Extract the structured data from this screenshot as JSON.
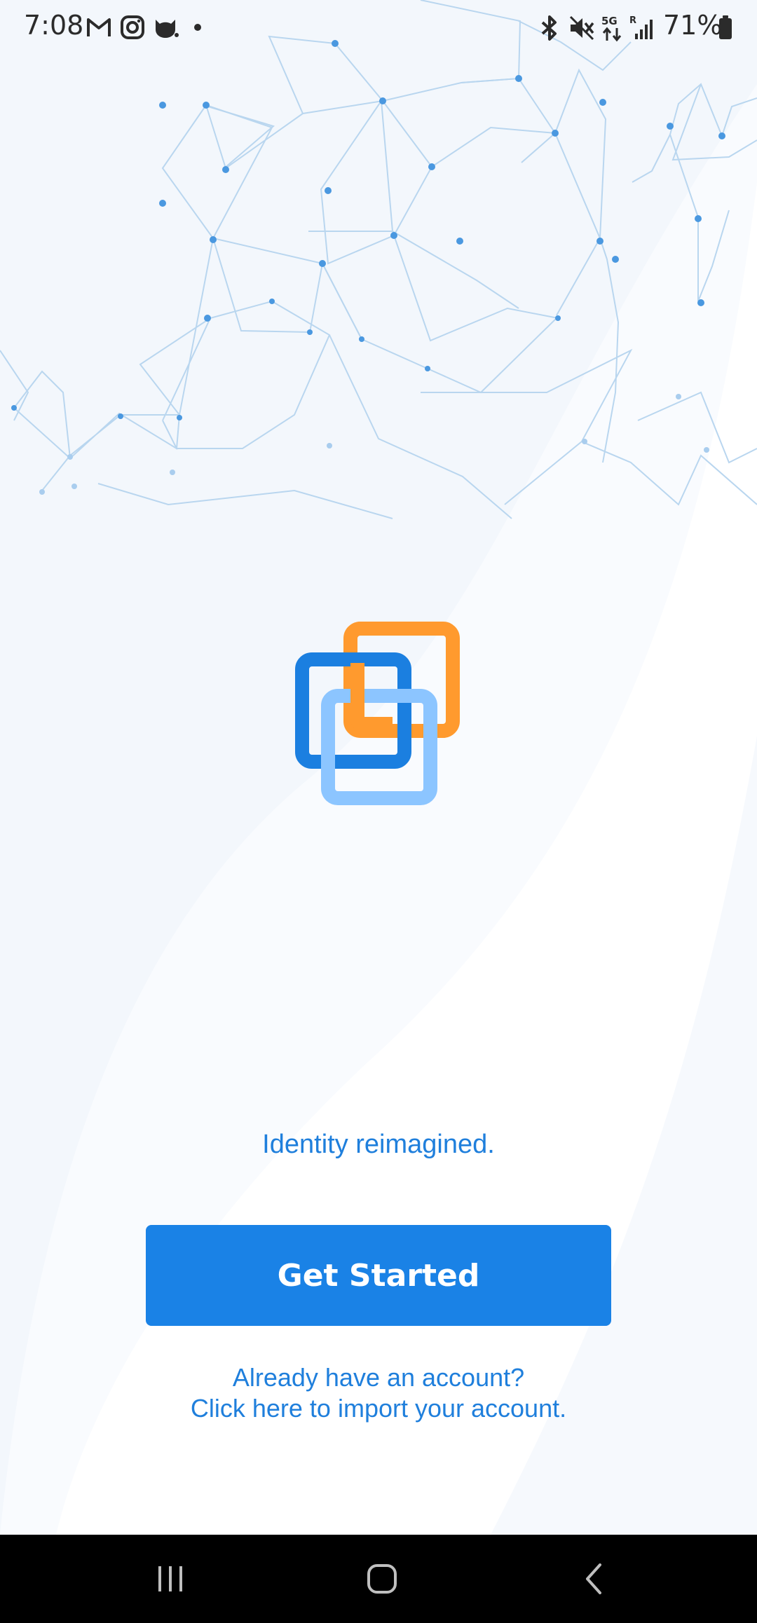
{
  "status_bar": {
    "time": "7:08",
    "battery_percent": "71%",
    "left_icons": [
      "gmail-icon",
      "instagram-icon",
      "cat-app-icon",
      "dot-icon"
    ],
    "right_icons": [
      "bluetooth-icon",
      "mute-icon",
      "5g-icon",
      "signal-icon",
      "battery-icon"
    ]
  },
  "onboarding": {
    "tagline": "Identity reimagined.",
    "cta_label": "Get Started",
    "import_line1": "Already have an account?",
    "import_line2": "Click here to import your account."
  },
  "logo": {
    "colors": {
      "dark_blue": "#1b7fe0",
      "orange": "#ff9a2e",
      "light_blue": "#8cc5ff"
    }
  },
  "nav_bar": {
    "buttons": [
      "recent-apps-icon",
      "home-icon",
      "back-icon"
    ]
  },
  "colors": {
    "accent": "#1a82e6",
    "link_text": "#1f7fdc",
    "background": "#f3f7fc",
    "network_lines": "#b9d6ef",
    "network_dots": "#4a98e0"
  }
}
